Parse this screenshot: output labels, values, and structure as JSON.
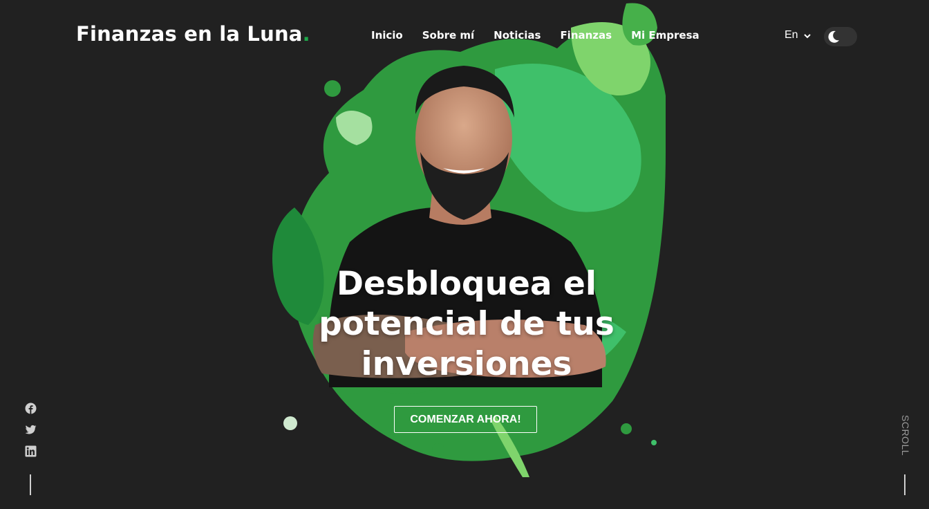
{
  "header": {
    "logo_text": "Finanzas en la Luna",
    "logo_dot": ".",
    "nav": [
      {
        "label": "Inicio"
      },
      {
        "label": "Sobre mí"
      },
      {
        "label": "Noticias"
      },
      {
        "label": "Finanzas"
      },
      {
        "label": "Mi Empresa"
      }
    ],
    "language": "En",
    "theme_toggle_icon": "moon-icon"
  },
  "hero": {
    "title_line1": "Desbloquea el",
    "title_line2": "potencial de tus",
    "title_line3": "inversiones",
    "cta_label": "COMENZAR AHORA!",
    "image_subject": "portrait over green paint splash"
  },
  "social": {
    "icons": [
      "facebook-icon",
      "twitter-icon",
      "linkedin-icon"
    ]
  },
  "scroll": {
    "label": "SCROLL"
  },
  "colors": {
    "background": "#212121",
    "accent": "#1ea84a",
    "text": "#ffffff"
  }
}
